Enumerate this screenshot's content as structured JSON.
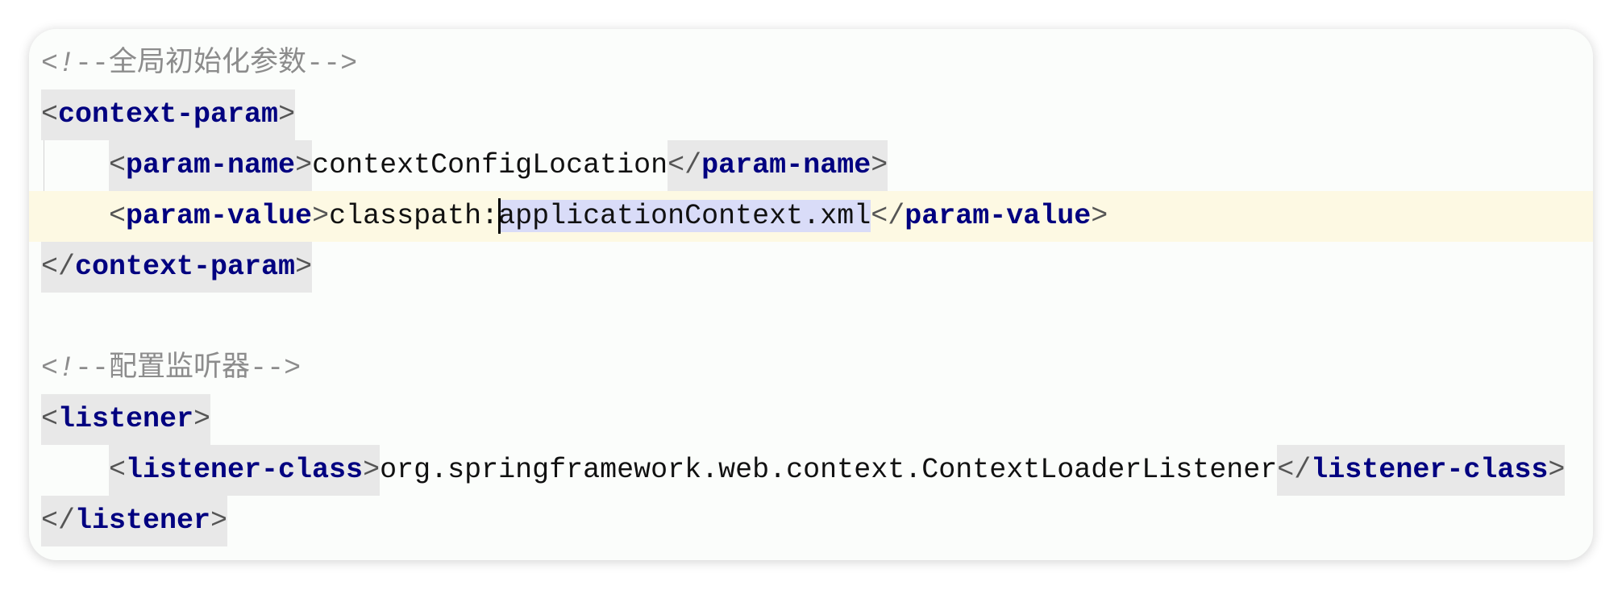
{
  "editor": {
    "comment1": "全局初始化参数",
    "context_param_tag": "context-param",
    "param_name_tag": "param-name",
    "param_name_value": "contextConfigLocation",
    "param_value_tag": "param-value",
    "param_value_prefix": "classpath:",
    "param_value_selected": "applicationContext.xml",
    "comment2": "配置监听器",
    "listener_tag": "listener",
    "listener_class_tag": "listener-class",
    "listener_class_value": "org.springframework.web.context.ContextLoaderListener"
  },
  "colors": {
    "tag": "#000080",
    "comment": "#8c8c8c",
    "current_line": "#fdf9e3",
    "selection": "#d9dcf8",
    "tag_highlight": "#e8e8e8"
  }
}
